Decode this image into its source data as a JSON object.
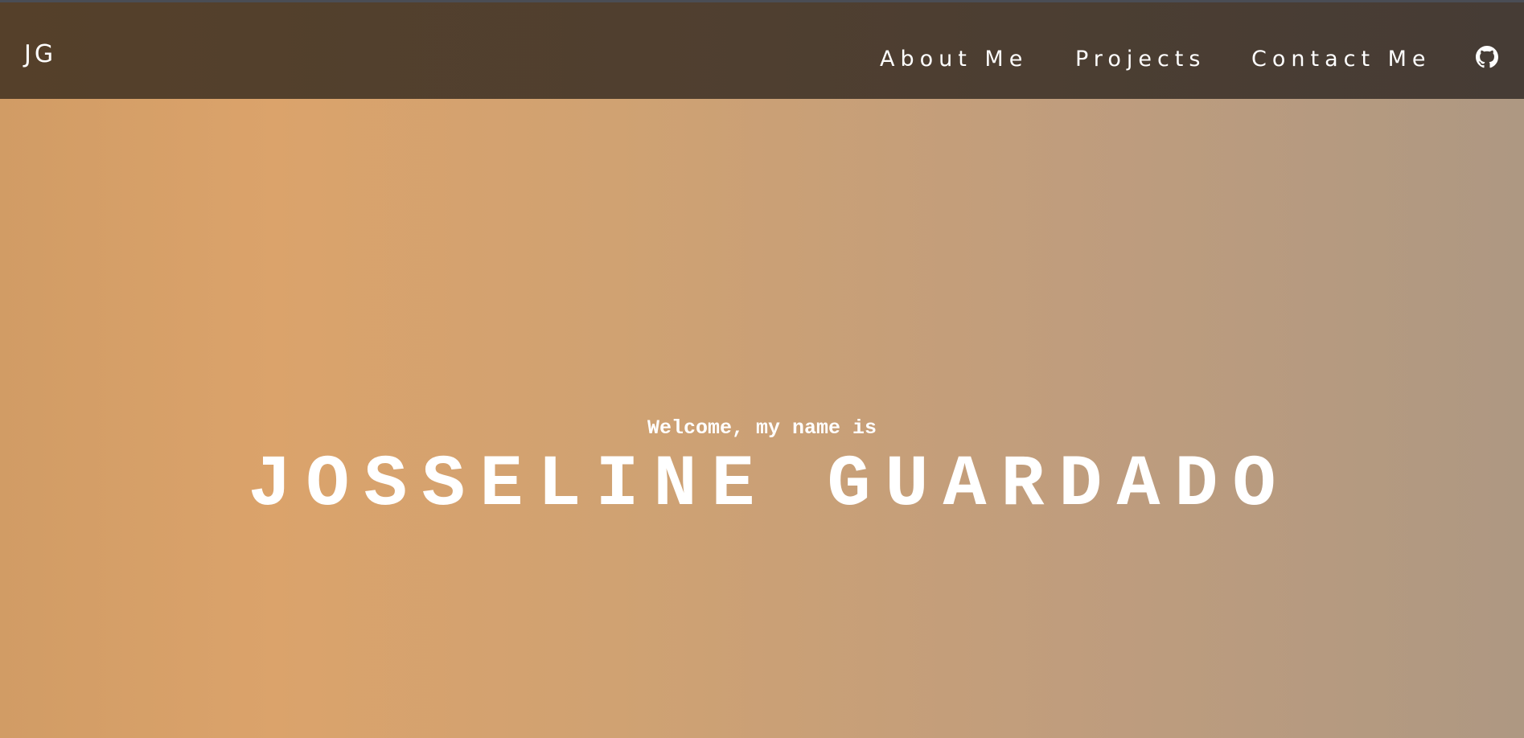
{
  "nav": {
    "logo": "JG",
    "links": [
      "About Me",
      "Projects",
      "Contact Me"
    ],
    "github_icon": "github-icon"
  },
  "hero": {
    "greeting": "Welcome, my name is",
    "name": "JOSSELINE GUARDADO"
  },
  "colors": {
    "nav_bg": "#55402a",
    "hero_left": "#d19c65",
    "hero_right": "#ae9882",
    "text": "#ffffff"
  }
}
